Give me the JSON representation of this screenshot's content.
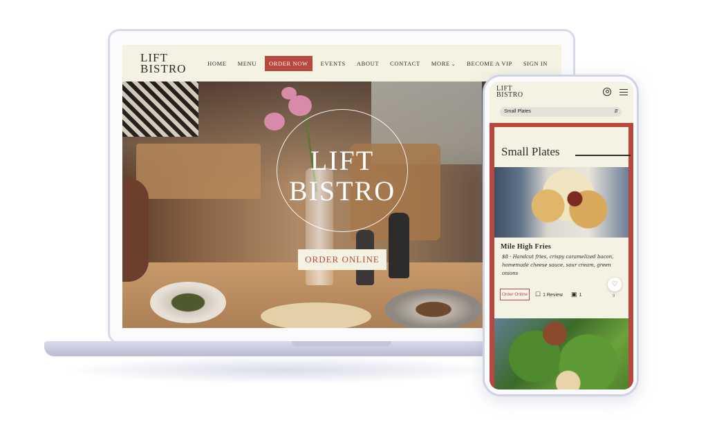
{
  "desktop": {
    "logo": {
      "line1": "LIFT",
      "line2": "BISTRO"
    },
    "nav": {
      "home": "HOME",
      "menu": "MENU",
      "order_now": "ORDER NOW",
      "events": "EVENTS",
      "about": "ABOUT",
      "contact": "CONTACT",
      "more": "MORE",
      "become_vip": "BECOME A VIP",
      "sign_in": "SIGN IN"
    },
    "hero": {
      "logo": {
        "line1": "LIFT",
        "line2": "BISTRO"
      },
      "cta": "ORDER ONLINE"
    }
  },
  "mobile": {
    "logo": {
      "line1": "LIFT",
      "line2": "BISTRO"
    },
    "category_select": {
      "value": "Small Plates"
    },
    "section_title": "Small Plates",
    "item": {
      "name": "Mile High Fries",
      "description": "$8 · Handcut fries, crispy caramelized bacon, homemade cheese sauce, sour cream, green onions",
      "order_button": "Order Online",
      "reviews": "1 Review",
      "photos": "1",
      "likes": "9"
    }
  },
  "colors": {
    "accent": "#b8473e",
    "cream": "#f4f2e3",
    "text": "#2d2a26"
  },
  "icons": [
    "chevron-down-icon",
    "user-icon",
    "hamburger-icon",
    "comment-icon",
    "image-icon",
    "heart-icon"
  ]
}
